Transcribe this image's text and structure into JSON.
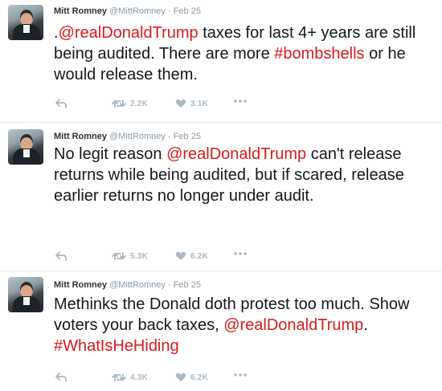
{
  "colors": {
    "link": "#e0191c",
    "muted": "#8899a6",
    "action": "#aab8c2"
  },
  "tweets": [
    {
      "name": "Mitt Romney",
      "handle": "@MittRomney",
      "sep": " · ",
      "date": "Feb 25",
      "text_parts": [
        {
          "t": "."
        },
        {
          "t": "@realDonaldTrump",
          "link": true
        },
        {
          "t": " taxes for last 4+ years are still being audited. There are more "
        },
        {
          "t": "#bombshells",
          "link": true
        },
        {
          "t": " or he would release them."
        }
      ],
      "retweets": "2.2K",
      "likes": "3.1K"
    },
    {
      "name": "Mitt Romney",
      "handle": "@MittRomney",
      "sep": " · ",
      "date": "Feb 25",
      "text_parts": [
        {
          "t": "No legit reason "
        },
        {
          "t": "@realDonaldTrump",
          "link": true
        },
        {
          "t": " can't release returns while being audited, but if scared, release earlier returns no longer under audit."
        }
      ],
      "retweets": "5.3K",
      "likes": "6.2K"
    },
    {
      "name": "Mitt Romney",
      "handle": "@MittRomney",
      "sep": " · ",
      "date": "Feb 25",
      "text_parts": [
        {
          "t": "Methinks the Donald doth protest too much. Show voters your back taxes, "
        },
        {
          "t": "@realDonaldTrump",
          "link": true
        },
        {
          "t": ". "
        },
        {
          "t": "#WhatIsHeHiding",
          "link": true
        }
      ],
      "retweets": "4.3K",
      "likes": "6.2K"
    }
  ],
  "icons": {
    "reply": "reply-arrow-icon",
    "retweet": "retweet-icon",
    "like": "heart-icon",
    "more": "more-dots-icon"
  }
}
